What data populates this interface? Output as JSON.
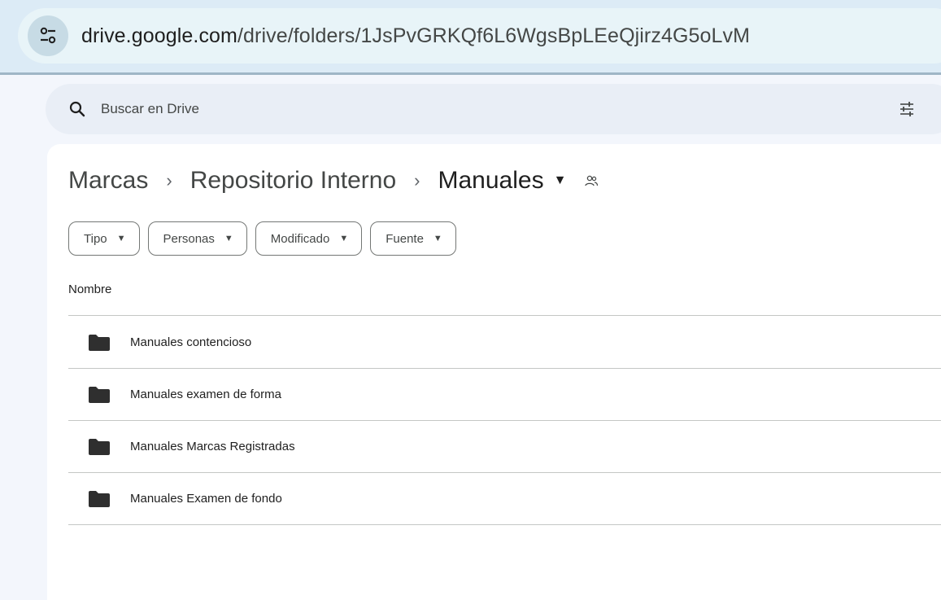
{
  "browser": {
    "url_host": "drive.google.com",
    "url_path": "/drive/folders/1JsPvGRKQf6L6WgsBpLEeQjirz4G5oLvM"
  },
  "search": {
    "placeholder": "Buscar en Drive"
  },
  "breadcrumb": {
    "items": [
      "Marcas",
      "Repositorio Interno"
    ],
    "separator": "›",
    "current": "Manuales"
  },
  "filters": [
    "Tipo",
    "Personas",
    "Modificado",
    "Fuente"
  ],
  "table": {
    "column_name": "Nombre",
    "rows": [
      "Manuales contencioso",
      "Manuales examen de forma",
      "Manuales Marcas Registradas",
      "Manuales Examen de fondo"
    ]
  },
  "icons": {
    "site_info": "tune-icon",
    "search": "search-icon",
    "filter": "filter-sliders-icon",
    "shared": "shared-people-icon",
    "folder": "folder-icon"
  },
  "colors": {
    "page_bg": "#f3f6fc",
    "search_bg": "#e9eef6",
    "folder": "#2f2f2f"
  }
}
